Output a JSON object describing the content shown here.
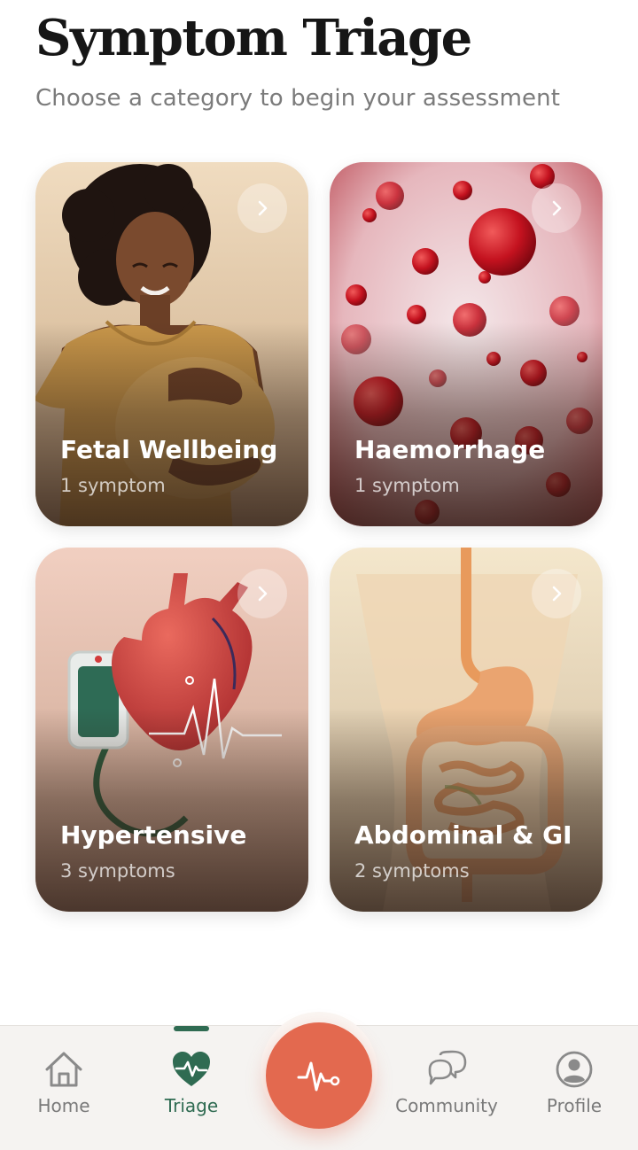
{
  "header": {
    "title": "Symptom Triage",
    "subtitle": "Choose a category to begin your assessment"
  },
  "categories": [
    {
      "name": "Fetal Wellbeing",
      "count": "1 symptom",
      "icon": "chevron-right-icon"
    },
    {
      "name": "Haemorrhage",
      "count": "1 symptom",
      "icon": "chevron-right-icon"
    },
    {
      "name": "Hypertensive",
      "count": "3 symptoms",
      "icon": "chevron-right-icon"
    },
    {
      "name": "Abdominal & GI",
      "count": "2 symptoms",
      "icon": "chevron-right-icon"
    }
  ],
  "bottom_nav": {
    "items": [
      {
        "label": "Home",
        "icon": "home-icon"
      },
      {
        "label": "Triage",
        "icon": "heart-pulse-icon",
        "active": true
      },
      {
        "label": "Community",
        "icon": "chat-bubbles-icon"
      },
      {
        "label": "Profile",
        "icon": "user-circle-icon"
      }
    ],
    "fab_icon": "pulse-icon"
  },
  "colors": {
    "accent": "#e3694f",
    "active_nav": "#2f6b52",
    "title": "#161616",
    "subtitle": "#7b7b7b"
  }
}
